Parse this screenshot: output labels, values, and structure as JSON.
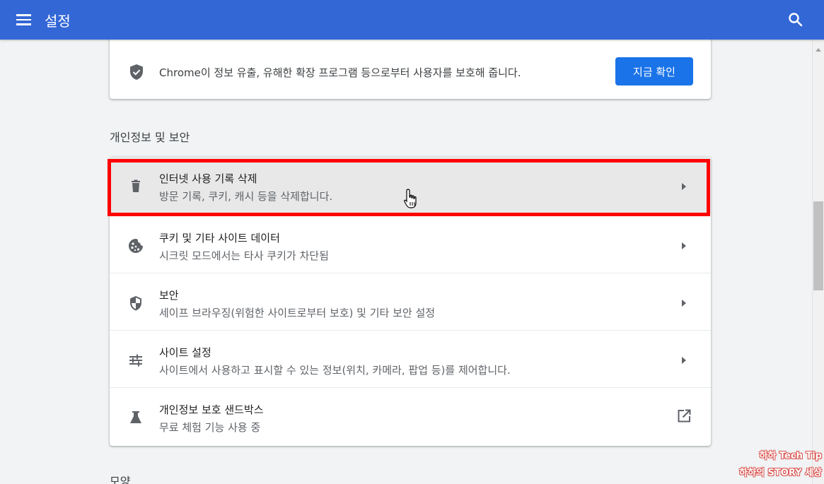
{
  "header": {
    "title": "설정",
    "menu_icon": "menu-icon",
    "search_icon": "search-icon",
    "bg_color": "#3367d6"
  },
  "safety_check": {
    "text": "Chrome이 정보 유출, 유해한 확장 프로그램 등으로부터 사용자를 보호해 줍니다.",
    "button_label": "지금 확인",
    "icon": "shield-check-icon",
    "button_color": "#1a73e8"
  },
  "privacy_section": {
    "title": "개인정보 및 보안",
    "items": [
      {
        "title": "인터넷 사용 기록 삭제",
        "subtitle": "방문 기록, 쿠키, 캐시 등을 삭제합니다.",
        "icon": "trash-icon",
        "highlighted": true
      },
      {
        "title": "쿠키 및 기타 사이트 데이터",
        "subtitle": "시크릿 모드에서는 타사 쿠키가 차단됨",
        "icon": "cookie-icon"
      },
      {
        "title": "보안",
        "subtitle": "세이프 브라우징(위험한 사이트로부터 보호) 및 기타 보안 설정",
        "icon": "security-shield-icon"
      },
      {
        "title": "사이트 설정",
        "subtitle": "사이트에서 사용하고 표시할 수 있는 정보(위치, 카메라, 팝업 등)를 제어합니다.",
        "icon": "tune-icon"
      },
      {
        "title": "개인정보 보호 샌드박스",
        "subtitle": "무료 체험 기능 사용 중",
        "icon": "flask-icon",
        "external": true
      }
    ]
  },
  "next_section": {
    "title": "모양"
  },
  "watermark": {
    "line1": "하하 Tech Tip",
    "line2": "하하의 STORY 세상"
  }
}
